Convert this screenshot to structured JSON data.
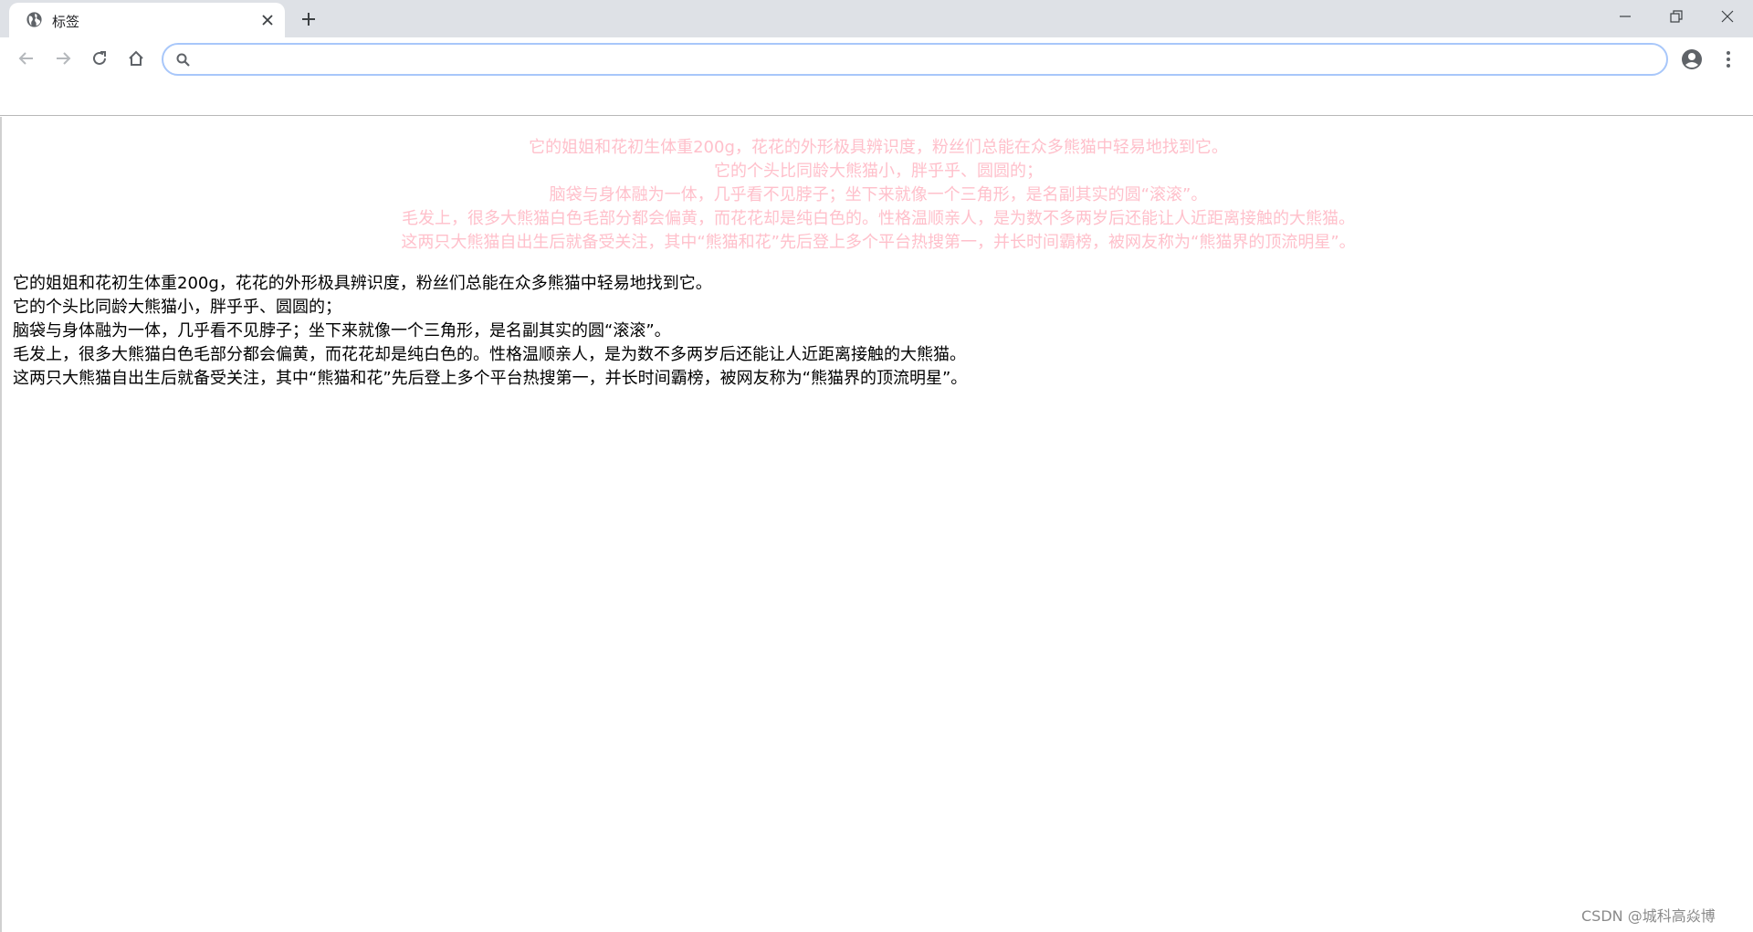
{
  "browser": {
    "tab_title": "标签",
    "tab_icon": "globe-icon",
    "omnibox_value": "",
    "accent_color": "#a8c7fa"
  },
  "content": {
    "text_color_centered": "#ffc0cb",
    "text_color_plain": "#000000",
    "centered_lines": [
      "它的姐姐和花初生体重200g，花花的外形极具辨识度，粉丝们总能在众多熊猫中轻易地找到它。",
      "它的个头比同龄大熊猫小，胖乎乎、圆圆的；",
      "脑袋与身体融为一体，几乎看不见脖子；坐下来就像一个三角形，是名副其实的圆“滚滚”。",
      "毛发上，很多大熊猫白色毛部分都会偏黄，而花花却是纯白色的。性格温顺亲人，是为数不多两岁后还能让人近距离接触的大熊猫。",
      "这两只大熊猫自出生后就备受关注，其中“熊猫和花”先后登上多个平台热搜第一，并长时间霸榜，被网友称为“熊猫界的顶流明星”。"
    ],
    "plain_lines": [
      "它的姐姐和花初生体重200g，花花的外形极具辨识度，粉丝们总能在众多熊猫中轻易地找到它。",
      "它的个头比同龄大熊猫小，胖乎乎、圆圆的；",
      "脑袋与身体融为一体，几乎看不见脖子；坐下来就像一个三角形，是名副其实的圆“滚滚”。",
      "毛发上，很多大熊猫白色毛部分都会偏黄，而花花却是纯白色的。性格温顺亲人，是为数不多两岁后还能让人近距离接触的大熊猫。",
      "这两只大熊猫自出生后就备受关注，其中“熊猫和花”先后登上多个平台热搜第一，并长时间霸榜，被网友称为“熊猫界的顶流明星”。"
    ]
  },
  "watermark": "CSDN @城科高焱博"
}
